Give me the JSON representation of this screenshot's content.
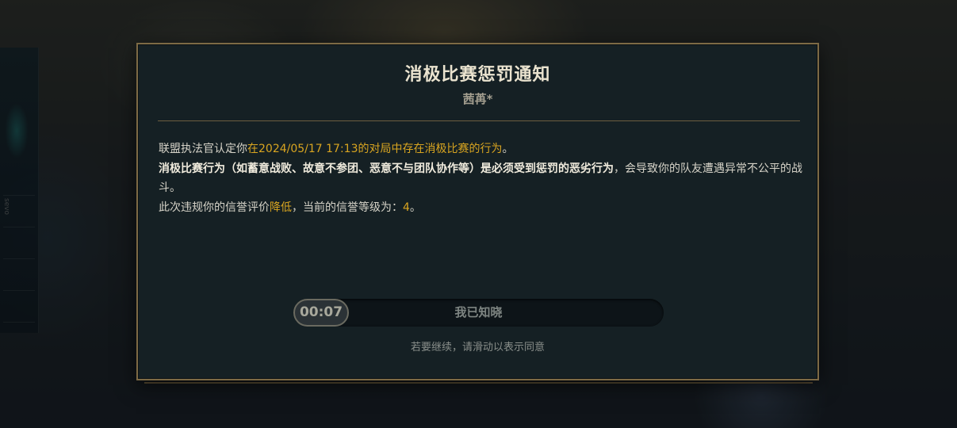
{
  "background": {
    "side_tag": "sevo"
  },
  "modal": {
    "title": "消极比赛惩罚通知",
    "player_name": "茜苒*",
    "line1": {
      "prefix": "联盟执法官认定你",
      "highlight": "在2024/05/17 17:13的对局中存在消极比赛的行为",
      "suffix": "。"
    },
    "line2": {
      "bold": "消极比赛行为（如蓄意战败、故意不参团、恶意不与团队协作等）是必须受到惩罚的恶劣行为",
      "rest": "，会导致你的队友遭遇异常不公平的战斗。"
    },
    "line3": {
      "prefix": "此次违规你的信誉评价",
      "highlight": "降低",
      "middle": "，当前的信誉等级为：",
      "level": "4",
      "suffix": "。"
    },
    "slider": {
      "timer": "00:07",
      "label": "我已知晓"
    },
    "hint": "若要继续，请滑动以表示同意"
  },
  "colors": {
    "highlight": "#d9a520",
    "border": "#7d6a45",
    "panel": "#152024"
  }
}
